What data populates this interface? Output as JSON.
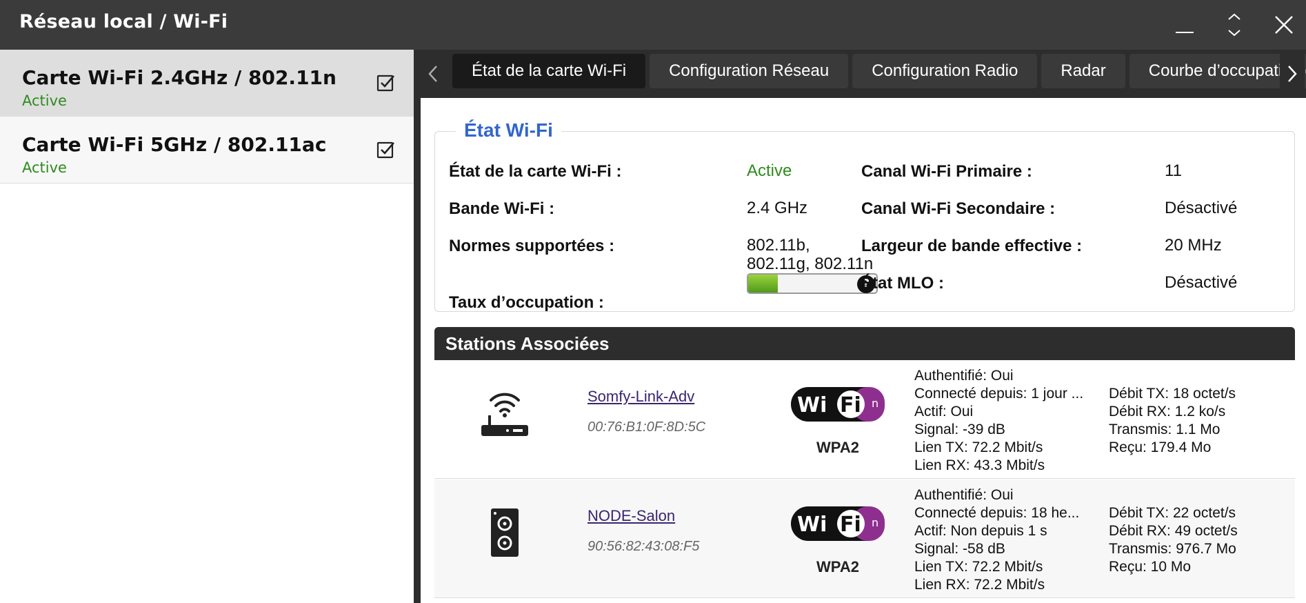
{
  "window": {
    "title": "Réseau local / Wi-Fi"
  },
  "cards": [
    {
      "name": "Carte Wi-Fi 2.4GHz / 802.11n",
      "status": "Active",
      "checked": true
    },
    {
      "name": "Carte Wi-Fi 5GHz / 802.11ac",
      "status": "Active",
      "checked": true
    }
  ],
  "tabs": [
    {
      "label": "État de la carte Wi-Fi"
    },
    {
      "label": "Configuration Réseau"
    },
    {
      "label": "Configuration Radio"
    },
    {
      "label": "Radar"
    },
    {
      "label": "Courbe d’occupation d"
    }
  ],
  "etat": {
    "legend": "État Wi-Fi",
    "etat_carte_label": "État de la carte Wi-Fi :",
    "etat_carte_value": "Active",
    "bande_label": "Bande Wi-Fi :",
    "bande_value": "2.4 GHz",
    "normes_label": "Normes supportées :",
    "normes_value_line1": "802.11b,",
    "normes_value_line2": "802.11g, 802.11n",
    "taux_label": "Taux d’occupation :",
    "taux_fraction": 0.23,
    "canal_primaire_label": "Canal Wi-Fi Primaire :",
    "canal_primaire_value": "11",
    "canal_secondaire_label": "Canal Wi-Fi Secondaire :",
    "canal_secondaire_value": "Désactivé",
    "largeur_label": "Largeur de bande effective :",
    "largeur_value": "20 MHz",
    "mlo_label": "État MLO :",
    "mlo_value": "Désactivé"
  },
  "stations": {
    "header": "Stations Associées",
    "items": [
      {
        "icon": "router-icon",
        "name": "Somfy-Link-Adv",
        "mac": "00:76:B1:0F:8D:5C",
        "security": "WPA2",
        "auth": "Authentifié: Oui",
        "connected": "Connecté depuis: 1 jour ...",
        "active": "Actif: Oui",
        "signal": "Signal: -39 dB",
        "link_tx": "Lien TX: 72.2 Mbit/s",
        "link_rx": "Lien RX: 43.3 Mbit/s",
        "debit_tx": "Débit TX: 18 octet/s",
        "debit_rx": "Débit RX: 1.2 ko/s",
        "transmis": "Transmis: 1.1 Mo",
        "recu": "Reçu: 179.4 Mo"
      },
      {
        "icon": "speaker-icon",
        "name": "NODE-Salon",
        "mac": "90:56:82:43:08:F5",
        "security": "WPA2",
        "auth": "Authentifié: Oui",
        "connected": "Connecté depuis: 18 he...",
        "active": "Actif: Non depuis 1 s",
        "signal": "Signal: -58 dB",
        "link_tx": "Lien TX: 72.2 Mbit/s",
        "link_rx": "Lien RX: 72.2 Mbit/s",
        "debit_tx": "Débit TX: 22 octet/s",
        "debit_rx": "Débit RX: 49 octet/s",
        "transmis": "Transmis: 976.7 Mo",
        "recu": "Reçu: 10 Mo"
      }
    ]
  },
  "colors": {
    "titlebar": "#3b3b3b",
    "active_green": "#2e8b1e",
    "legend_blue": "#3366cc",
    "link_purple": "#3a2570",
    "wifi_purple": "#8e2f8f"
  }
}
